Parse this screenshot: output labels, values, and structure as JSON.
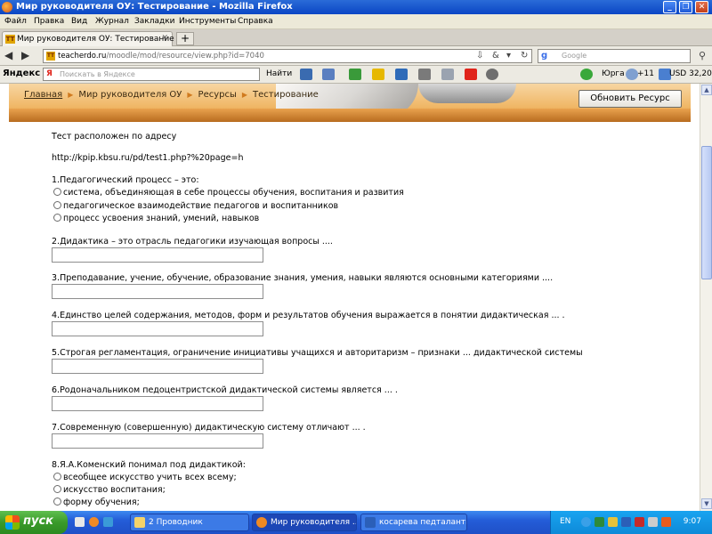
{
  "window": {
    "title": "Мир руководителя ОУ: Тестирование - Mozilla Firefox"
  },
  "menu": [
    "Файл",
    "Правка",
    "Вид",
    "Журнал",
    "Закладки",
    "Инструменты",
    "Справка"
  ],
  "tab": {
    "label": "Мир руководителя ОУ: Тестирование",
    "new_tab": "+"
  },
  "nav": {
    "url_host": "teacherdo.ru",
    "url_path": "/moodle/mod/resource/view.php?id=7040",
    "search_placeholder": "Google"
  },
  "yandex": {
    "logo": "Яндекс",
    "search_placeholder": "Поискать в Яндексе",
    "find_label": "Найти",
    "city": "Юрга",
    "temperature": "+11",
    "currency": "USD 32,20"
  },
  "page": {
    "breadcrumb": [
      "Главная",
      "Мир руководителя ОУ",
      "Ресурсы",
      "Тестирование"
    ],
    "refresh_button": "Обновить Ресурс",
    "intro": "Тест расположен по адресу",
    "test_url": "http://kpip.kbsu.ru/pd/test1.php?%20page=h",
    "q1": {
      "text": "1.Педагогический процесс – это:",
      "options": [
        "система, объединяющая в себе процессы обучения, воспитания и развития",
        "педагогическое взаимодействие педагогов и воспитанников",
        "процесс усвоения знаний, умений, навыков"
      ]
    },
    "q2": "2.Дидактика – это отрасль педагогики изучающая вопросы ....",
    "q3": "3.Преподавание, учение, обучение, образование знания, умения, навыки являются основными категориями ....",
    "q4": "4.Единство целей содержания, методов, форм и результатов обучения выражается в понятии дидактическая ... .",
    "q5": "5.Строгая регламентация, ограничение инициативы учащихся и авторитаризм – признаки ... дидактической системы",
    "q6": "6.Родоначальником педоцентристской дидактической системы является ... .",
    "q7": "7.Современную (совершенную) дидактическую систему отличают ... .",
    "q8": {
      "text": "8.Я.А.Коменский понимал под дидактикой:",
      "options": [
        "всеобщее искусство учить всех всему;",
        "искусство воспитания;",
        "форму обучения;"
      ]
    }
  },
  "taskbar": {
    "start": "пуск",
    "items": [
      "2 Проводник",
      "Мир руководителя ...",
      "косарева педталанты"
    ],
    "lang": "EN",
    "clock": "9:07"
  },
  "colors": {
    "title_bar": "#0a46c4",
    "banner": "#f0b766",
    "taskbar": "#245dd8",
    "start": "#3a9a2a"
  }
}
